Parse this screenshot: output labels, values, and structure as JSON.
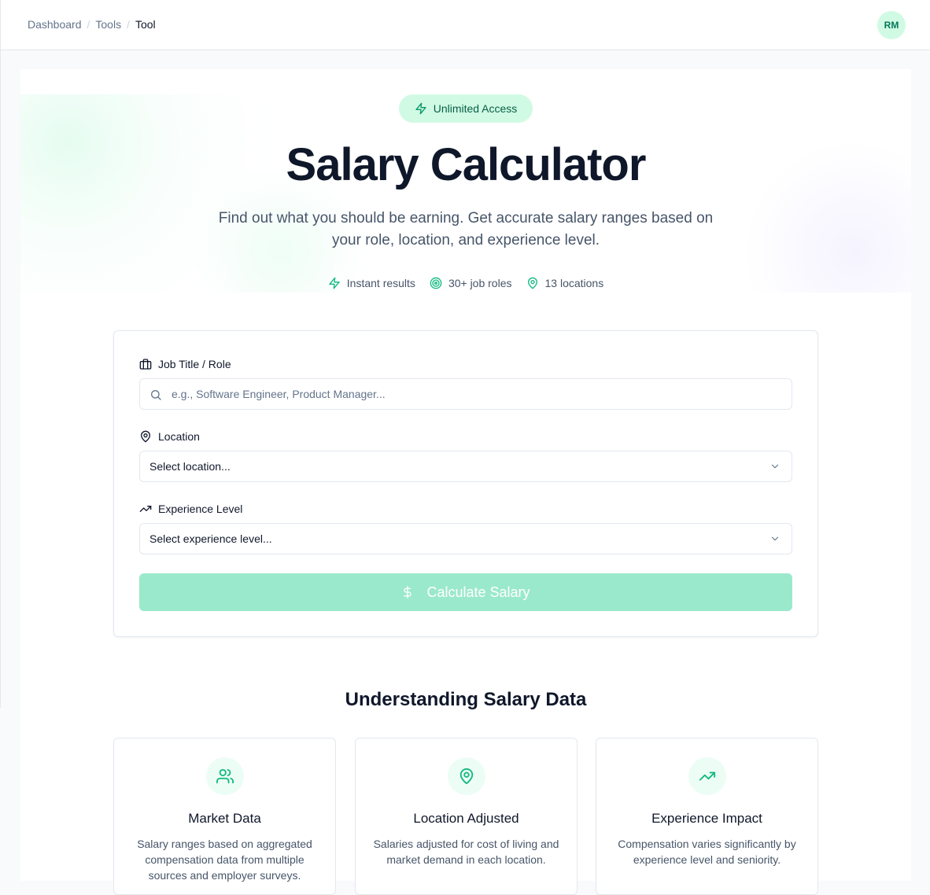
{
  "breadcrumb": {
    "items": [
      "Dashboard",
      "Tools"
    ],
    "current": "Tool"
  },
  "user": {
    "initials": "RM"
  },
  "badge": {
    "label": "Unlimited Access",
    "icon": "zap-icon"
  },
  "hero": {
    "title": "Salary Calculator",
    "subtitle": "Find out what you should be earning. Get accurate salary ranges based on your role, location, and experience level."
  },
  "features": [
    {
      "icon": "zap-icon",
      "label": "Instant results"
    },
    {
      "icon": "target-icon",
      "label": "30+ job roles"
    },
    {
      "icon": "map-pin-icon",
      "label": "13 locations"
    }
  ],
  "form": {
    "job": {
      "label": "Job Title / Role",
      "placeholder": "e.g., Software Engineer, Product Manager...",
      "value": ""
    },
    "location": {
      "label": "Location",
      "value": "Select location..."
    },
    "experience": {
      "label": "Experience Level",
      "value": "Select experience level..."
    },
    "submit_label": "Calculate Salary"
  },
  "section": {
    "title": "Understanding Salary Data"
  },
  "info_cards": [
    {
      "icon": "users-icon",
      "title": "Market Data",
      "desc": "Salary ranges based on aggregated compensation data from multiple sources and employer surveys."
    },
    {
      "icon": "map-pin-icon",
      "title": "Location Adjusted",
      "desc": "Salaries adjusted for cost of living and market demand in each location."
    },
    {
      "icon": "trending-up-icon",
      "title": "Experience Impact",
      "desc": "Compensation varies significantly by experience level and seniority."
    }
  ],
  "colors": {
    "accent": "#10b981",
    "accent_light": "#d1fae5",
    "button_disabled": "#9be9cc"
  }
}
